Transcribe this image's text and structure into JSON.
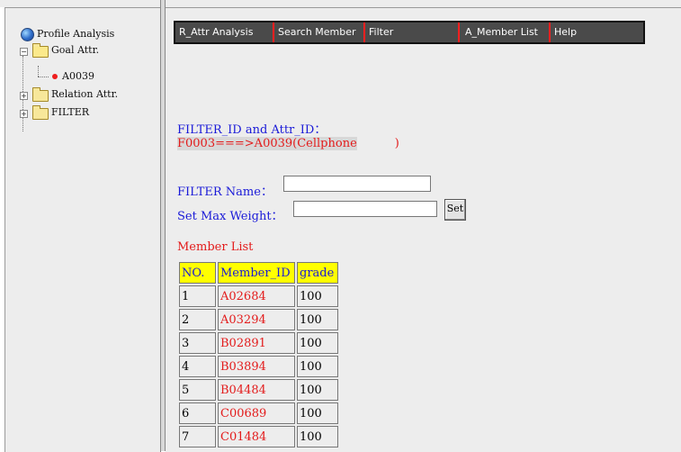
{
  "tree": {
    "root": "Profile Analysis",
    "goal": "Goal Attr.",
    "goal_child": "A0039",
    "relation": "Relation Attr.",
    "filter": "FILTER",
    "collapse_glyph": "−",
    "expand_glyph": "+"
  },
  "menu": {
    "items": [
      "R_Attr Analysis",
      "Search Member",
      "Filter",
      "A_Member List",
      "Help"
    ]
  },
  "form": {
    "filter_attr_heading": "FILTER_ID and Attr_ID：",
    "filter_attr_value": "F0003===>A0039(Cellphone",
    "filter_attr_close": ")",
    "filter_name_label": "FILTER Name：",
    "filter_name_value": "",
    "max_weight_label": "Set Max Weight：",
    "max_weight_value": "",
    "set_button": "Set"
  },
  "member_list": {
    "title": "Member List",
    "columns": [
      "NO.",
      "Member_ID",
      "grade"
    ],
    "rows": [
      [
        "1",
        "A02684",
        "100"
      ],
      [
        "2",
        "A03294",
        "100"
      ],
      [
        "3",
        "B02891",
        "100"
      ],
      [
        "4",
        "B03894",
        "100"
      ],
      [
        "5",
        "B04484",
        "100"
      ],
      [
        "6",
        "C00689",
        "100"
      ],
      [
        "7",
        "C01484",
        "100"
      ]
    ]
  },
  "colors": {
    "label_blue": "#1a1ad8",
    "value_red": "#e31b1b",
    "header_yellow": "#ffff00",
    "menu_bg": "#4a4a4a"
  },
  "icons": [
    "globe-icon",
    "folder-open-icon",
    "folder-icon",
    "leaf-dot-icon"
  ]
}
